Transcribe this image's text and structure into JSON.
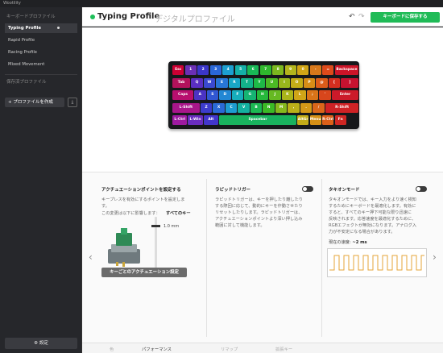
{
  "app": {
    "title": "Wootility"
  },
  "sidebar": {
    "header": "キーボードプロファイル",
    "profiles": [
      {
        "label": "Typing Profile",
        "active": true
      },
      {
        "label": "Rapid Profile"
      },
      {
        "label": "Racing Profile"
      },
      {
        "label": "Mixed Movement"
      }
    ],
    "saved_header": "保存済プロファイル",
    "create_label": "プロファイルを作成",
    "settings_label": "設定"
  },
  "header": {
    "profile_name": "Typing Profile",
    "profile_subtitle": "デジタルプロファイル",
    "save_label": "キーボードに保存する"
  },
  "keyboard": {
    "rows": [
      [
        {
          "label": "Esc",
          "color": "#cc0033"
        },
        {
          "label": "1",
          "color": "#6b2fb5"
        },
        {
          "label": "2",
          "color": "#3b36c9"
        },
        {
          "label": "3",
          "color": "#2a67d8"
        },
        {
          "label": "4",
          "color": "#1c9fd0"
        },
        {
          "label": "5",
          "color": "#14b0a8"
        },
        {
          "label": "6",
          "color": "#18b856"
        },
        {
          "label": "7",
          "color": "#2fb82d"
        },
        {
          "label": "8",
          "color": "#7cb81f"
        },
        {
          "label": "9",
          "color": "#b3b51c"
        },
        {
          "label": "0",
          "color": "#d1a516"
        },
        {
          "label": "-",
          "color": "#d8781a"
        },
        {
          "label": "=",
          "color": "#dd4a1b"
        },
        {
          "label": "Backspace",
          "color": "#cc1428"
        }
      ],
      [
        {
          "label": "Tab",
          "color": "#b3125c"
        },
        {
          "label": "Q",
          "color": "#5a2fc1"
        },
        {
          "label": "W",
          "color": "#3a49d0"
        },
        {
          "label": "E",
          "color": "#2876d6"
        },
        {
          "label": "R",
          "color": "#19a7c7"
        },
        {
          "label": "T",
          "color": "#13b28a"
        },
        {
          "label": "Y",
          "color": "#1eb947"
        },
        {
          "label": "U",
          "color": "#4cb925"
        },
        {
          "label": "I",
          "color": "#98b81c"
        },
        {
          "label": "O",
          "color": "#c4ad18"
        },
        {
          "label": "P",
          "color": "#d78d17"
        },
        {
          "label": "@",
          "color": "#db5c1a"
        },
        {
          "label": "[",
          "color": "#d42e1f"
        },
        {
          "label": "]",
          "color": "#c81230"
        }
      ],
      [
        {
          "label": "Caps",
          "color": "#b80f6e"
        },
        {
          "label": "A",
          "color": "#4b33c4"
        },
        {
          "label": "S",
          "color": "#3157d2"
        },
        {
          "label": "D",
          "color": "#2287d4"
        },
        {
          "label": "F",
          "color": "#17adbb"
        },
        {
          "label": "G",
          "color": "#15b473"
        },
        {
          "label": "H",
          "color": "#26b93b"
        },
        {
          "label": "J",
          "color": "#66b922"
        },
        {
          "label": "K",
          "color": "#aab51a"
        },
        {
          "label": "L",
          "color": "#cfa517"
        },
        {
          "label": ";",
          "color": "#d97419"
        },
        {
          "label": "'",
          "color": "#d8461c"
        },
        {
          "label": "Enter",
          "color": "#cc1a2a"
        }
      ],
      [
        {
          "label": "L-Shift",
          "color": "#a8168a"
        },
        {
          "label": "Z",
          "color": "#3c3ccc"
        },
        {
          "label": "X",
          "color": "#2a6ad6"
        },
        {
          "label": "C",
          "color": "#1d9cd1"
        },
        {
          "label": "V",
          "color": "#14b1a0"
        },
        {
          "label": "B",
          "color": "#1cb852"
        },
        {
          "label": "N",
          "color": "#3bb925"
        },
        {
          "label": "M",
          "color": "#86b81d"
        },
        {
          "label": ",",
          "color": "#bcb019"
        },
        {
          "label": ".",
          "color": "#d59817"
        },
        {
          "label": "/",
          "color": "#da661a"
        },
        {
          "label": "R-Shift",
          "color": "#cf2225"
        }
      ],
      [
        {
          "label": "L-Ctrl",
          "color": "#9d1aa0"
        },
        {
          "label": "L-Win",
          "color": "#6a2dbf"
        },
        {
          "label": "Alt",
          "color": "#4236cc"
        },
        {
          "label": "Spacebar",
          "color": "#19b25e"
        },
        {
          "label": "AltGr",
          "color": "#c4ac18"
        },
        {
          "label": "Menu",
          "color": "#d69016"
        },
        {
          "label": "R-Ctrl",
          "color": "#db5f19"
        },
        {
          "label": "Fn",
          "color": "#cf2623"
        }
      ]
    ]
  },
  "panels": {
    "actuation": {
      "title": "アクチュエーションポイントを設定する",
      "desc1": "キープレスを有効にするポイントを設定しま",
      "desc2": "す。",
      "desc3": "この変更は以下に影響します：",
      "scope": "すべてのキー",
      "value": "1.0 mm",
      "per_key_label": "キーごとのアクチュエーション設定"
    },
    "rapid": {
      "title": "ラピッドトリガー",
      "lines": [
        "ラピッドトリガーは、キーを押したり離したり",
        "する際回に応じて、動的にキーを作動させたり",
        "リセットしたりします。ラピッドトリガーは、",
        "アクチュエーションポイントより深い押し込み",
        "範囲に対して機能します。"
      ]
    },
    "tachyon": {
      "title": "タキオンモード",
      "lines": [
        "タキオンモードでは、キー入力をより速く検知",
        "するためにキーボードを最適化します。有効に",
        "すると、すべてのキー押下可能な限り迅速に",
        "反映されます。応答速度を最適化するために、",
        "RGBエフェクトが無効になります。アナログ入",
        "力が不安定になる場合があります。"
      ],
      "speed_label": "現在の速度:",
      "speed_value": "~2 ms"
    }
  },
  "bottom_tabs": [
    {
      "label": "色"
    },
    {
      "label": "パフォーマンス",
      "active": true
    },
    {
      "label": "リマップ"
    },
    {
      "label": "拡張キー"
    }
  ]
}
